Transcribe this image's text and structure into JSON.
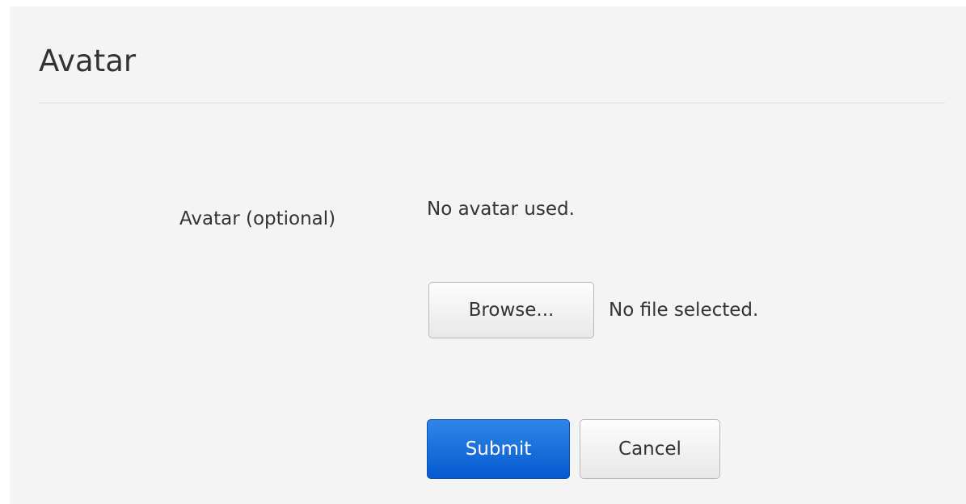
{
  "section": {
    "title": "Avatar"
  },
  "avatar_field": {
    "label": "Avatar (optional)",
    "current_value": "No avatar used.",
    "browse_label": "Browse...",
    "file_status": "No file selected."
  },
  "actions": {
    "submit_label": "Submit",
    "cancel_label": "Cancel"
  },
  "colors": {
    "panel_background": "#f4f4f4",
    "primary_button": "#0759d1",
    "divider": "#dcdcdc"
  }
}
